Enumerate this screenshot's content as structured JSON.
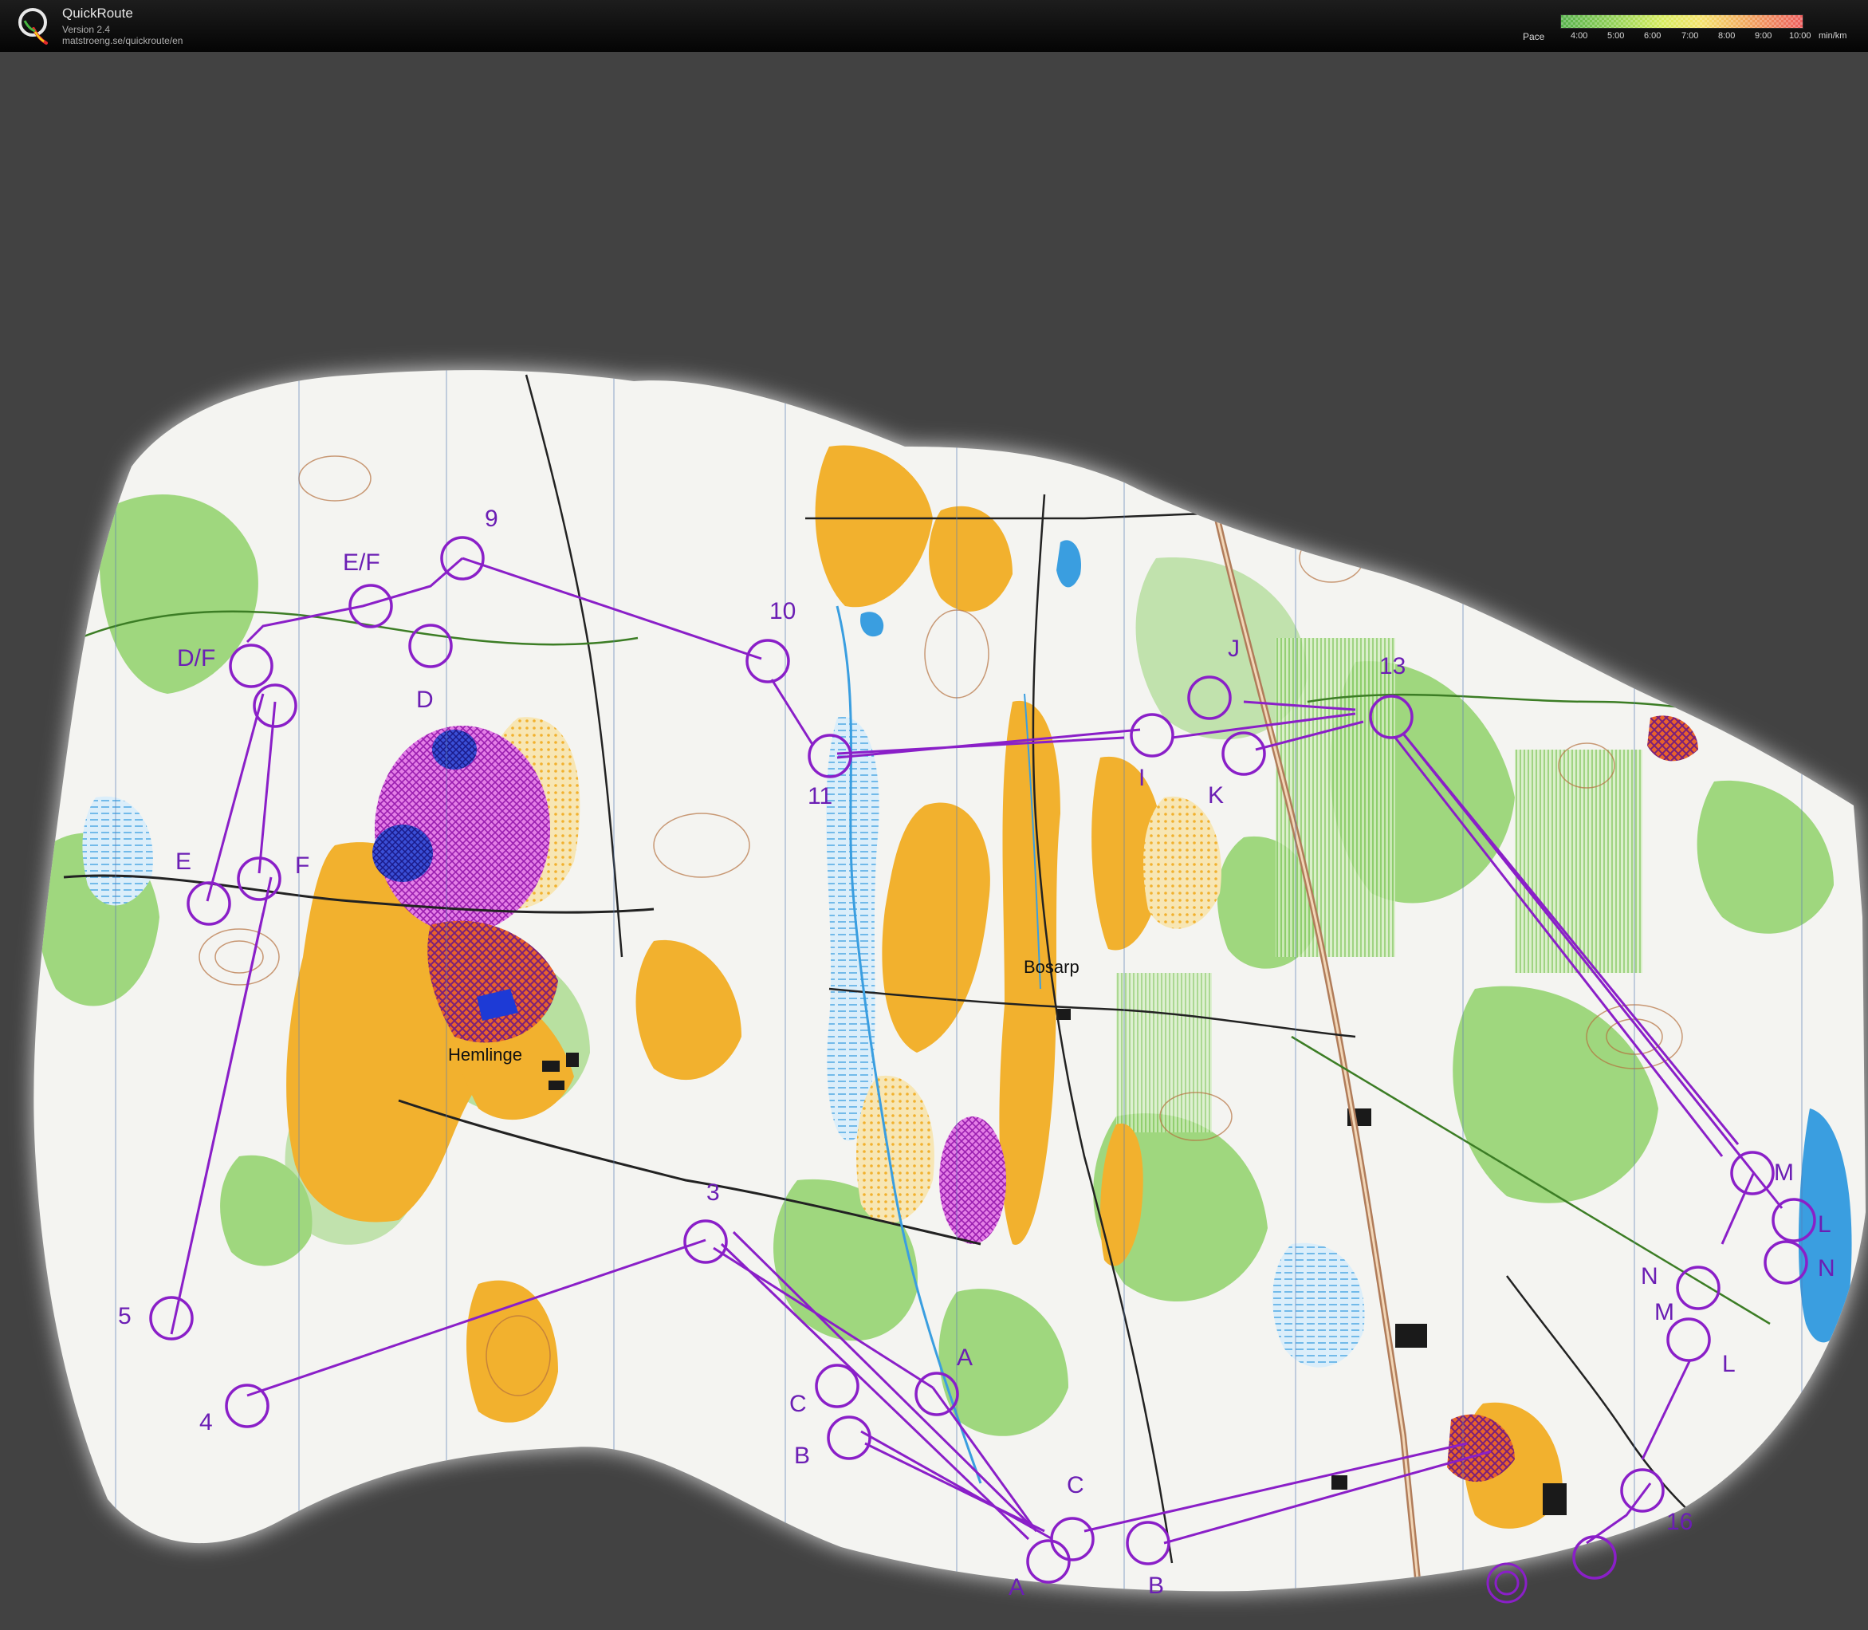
{
  "app": {
    "name": "QuickRoute",
    "version": "Version 2.4",
    "url": "matstroeng.se/quickroute/en",
    "logo_letter": "Q"
  },
  "pace_legend": {
    "label": "Pace",
    "ticks": [
      "4:00",
      "5:00",
      "6:00",
      "7:00",
      "8:00",
      "9:00",
      "10:00"
    ],
    "units": "min/km",
    "colors": [
      "#55b04a",
      "#92d155",
      "#d7ec5d",
      "#f5e26a",
      "#f2a95c",
      "#ec5c5c"
    ]
  },
  "map": {
    "place_names": {
      "hemlinge": "Hemlinge",
      "bosarp": "Bosarp"
    },
    "controls": [
      "3",
      "4",
      "5",
      "9",
      "10",
      "11",
      "13",
      "16"
    ],
    "butterfly_labels": [
      "A",
      "B",
      "C",
      "D",
      "D/F",
      "E",
      "E/F",
      "F",
      "I",
      "J",
      "K",
      "L",
      "M",
      "N"
    ],
    "colors": {
      "course": "#8a1fc8",
      "field": "#f2b12e",
      "forest_green": "#7fca5a",
      "water": "#3a9ee0",
      "background": "#424242"
    }
  }
}
